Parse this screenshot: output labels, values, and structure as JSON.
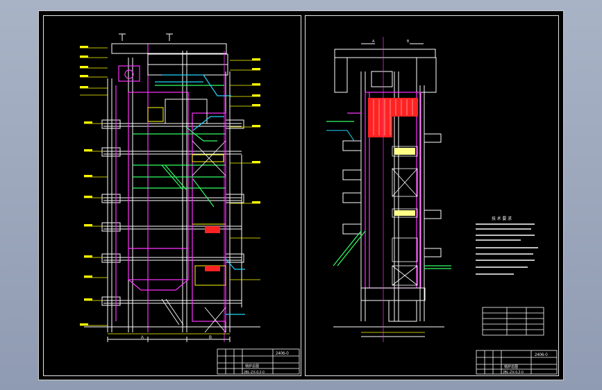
{
  "colors": {
    "background": "#000000",
    "frame": "#e8e8e8",
    "structure": "#ffffff",
    "magenta": "#ff33ff",
    "yellow": "#ffff00",
    "green": "#33ff66",
    "cyan": "#22d6ff",
    "red": "#ff2222"
  },
  "left_view": {
    "section_markers": [
      "A",
      "B"
    ],
    "title_block": {
      "drawing_code": "2406-0",
      "name": "锅炉总图",
      "number": "JBL-ZX-0.2-0"
    }
  },
  "right_view": {
    "top_markers": [
      "A",
      "B"
    ],
    "notes_title": "技 术 要 求",
    "title_block": {
      "drawing_code": "2406-0",
      "name": "锅炉总图",
      "number": "JBL-ZX-0.2-0"
    }
  }
}
